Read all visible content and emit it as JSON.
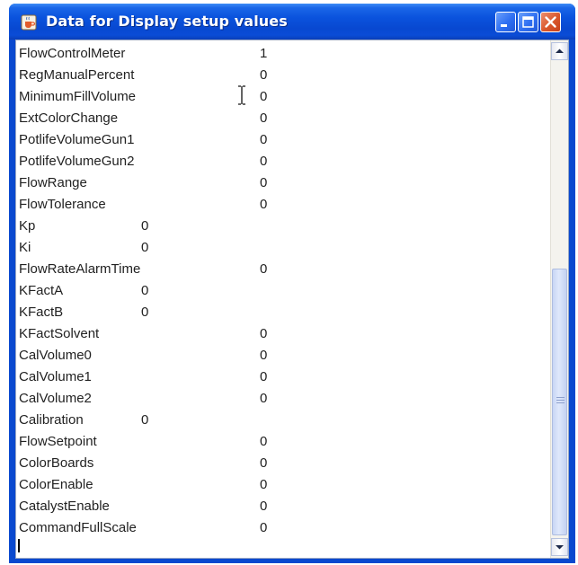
{
  "window": {
    "title": "Data for Display setup values"
  },
  "rows": [
    {
      "name": "FlowControlMeter",
      "value": "1",
      "column": "right"
    },
    {
      "name": "RegManualPercent",
      "value": "0",
      "column": "right"
    },
    {
      "name": "MinimumFillVolume",
      "value": "0",
      "column": "right"
    },
    {
      "name": "ExtColorChange",
      "value": "0",
      "column": "right"
    },
    {
      "name": "PotlifeVolumeGun1",
      "value": "0",
      "column": "right"
    },
    {
      "name": "PotlifeVolumeGun2",
      "value": "0",
      "column": "right"
    },
    {
      "name": "FlowRange",
      "value": "0",
      "column": "right"
    },
    {
      "name": "FlowTolerance",
      "value": "0",
      "column": "right"
    },
    {
      "name": "Kp",
      "value": "0",
      "column": "left"
    },
    {
      "name": "Ki",
      "value": "0",
      "column": "left"
    },
    {
      "name": "FlowRateAlarmTime",
      "value": "0",
      "column": "right"
    },
    {
      "name": "KFactA",
      "value": "0",
      "column": "left"
    },
    {
      "name": "KFactB",
      "value": "0",
      "column": "left"
    },
    {
      "name": "KFactSolvent",
      "value": "0",
      "column": "right"
    },
    {
      "name": "CalVolume0",
      "value": "0",
      "column": "right"
    },
    {
      "name": "CalVolume1",
      "value": "0",
      "column": "right"
    },
    {
      "name": "CalVolume2",
      "value": "0",
      "column": "right"
    },
    {
      "name": "Calibration",
      "value": "0",
      "column": "left"
    },
    {
      "name": "FlowSetpoint",
      "value": "0",
      "column": "right"
    },
    {
      "name": "ColorBoards",
      "value": "0",
      "column": "right"
    },
    {
      "name": "ColorEnable",
      "value": "0",
      "column": "right"
    },
    {
      "name": "CatalystEnable",
      "value": "0",
      "column": "right"
    },
    {
      "name": "CommandFullScale",
      "value": "0",
      "column": "right"
    }
  ]
}
